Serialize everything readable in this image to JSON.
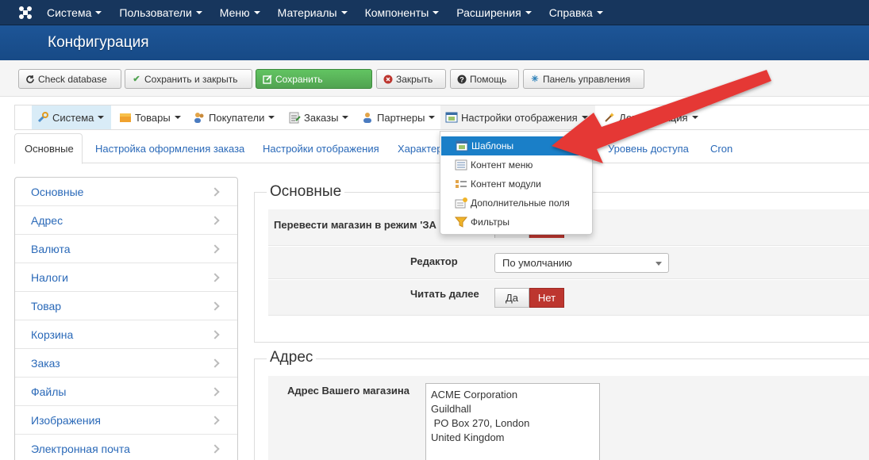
{
  "topbar": {
    "menu": [
      {
        "label": "Система"
      },
      {
        "label": "Пользователи"
      },
      {
        "label": "Меню"
      },
      {
        "label": "Материалы"
      },
      {
        "label": "Компоненты"
      },
      {
        "label": "Расширения"
      },
      {
        "label": "Справка"
      }
    ]
  },
  "header": {
    "title": "Конфигурация"
  },
  "toolbar": {
    "check_db": "Check database",
    "save_close": "Сохранить и закрыть",
    "save": "Сохранить",
    "close": "Закрыть",
    "help": "Помощь",
    "control_panel": "Панель управления"
  },
  "component_menu": {
    "items": [
      {
        "label": "Система"
      },
      {
        "label": "Товары"
      },
      {
        "label": "Покупатели"
      },
      {
        "label": "Заказы"
      },
      {
        "label": "Партнеры"
      },
      {
        "label": "Настройки отображения"
      },
      {
        "label": "Документация"
      }
    ]
  },
  "dropdown": {
    "items": [
      {
        "label": "Шаблоны"
      },
      {
        "label": "Контент меню"
      },
      {
        "label": "Контент модули"
      },
      {
        "label": "Дополнительные поля"
      },
      {
        "label": "Фильтры"
      }
    ]
  },
  "tabs": [
    {
      "label": "Основные"
    },
    {
      "label": "Настройка оформления заказа"
    },
    {
      "label": "Настройки отображения"
    },
    {
      "label": "Характер"
    },
    {
      "label": "Уровень доступа"
    },
    {
      "label": "Cron"
    }
  ],
  "sidebar": {
    "items": [
      {
        "label": "Основные"
      },
      {
        "label": "Адрес"
      },
      {
        "label": "Валюта"
      },
      {
        "label": "Налоги"
      },
      {
        "label": "Товар"
      },
      {
        "label": "Корзина"
      },
      {
        "label": "Заказ"
      },
      {
        "label": "Файлы"
      },
      {
        "label": "Изображения"
      },
      {
        "label": "Электронная почта"
      }
    ]
  },
  "main": {
    "section_basic": "Основные",
    "shop_mode_label": "Перевести магазин в режим 'ЗА",
    "editor_label": "Редактор",
    "editor_value": "По умолчанию",
    "read_more_label": "Читать далее",
    "yes": "Да",
    "no": "Нет",
    "section_address": "Адрес",
    "address_label": "Адрес Вашего магазина",
    "address_value": "ACME Corporation\nGuildhall\n PO Box 270, London\nUnited Kingdom"
  },
  "colors": {
    "navbar": "#17365d",
    "header": "#1d5597",
    "link": "#2a69b8",
    "accent_red": "#bd362f",
    "arrow_red": "#e53935",
    "selected": "#1a7fc8"
  }
}
